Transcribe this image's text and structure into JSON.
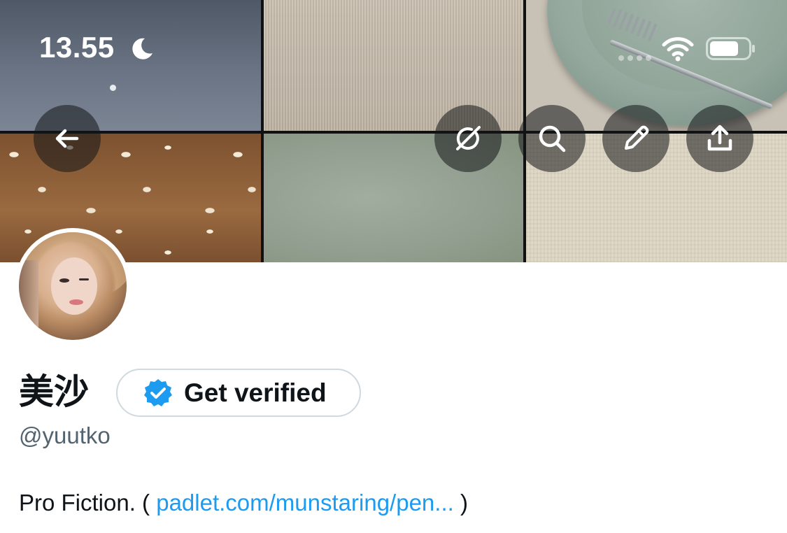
{
  "status_bar": {
    "time": "13.55",
    "icons": [
      "moon-icon",
      "cellular-dots-icon",
      "wifi-icon",
      "battery-icon"
    ]
  },
  "header_actions": {
    "icons": [
      "back-arrow-icon",
      "grok-icon",
      "search-icon",
      "pencil-icon",
      "share-icon"
    ]
  },
  "profile": {
    "display_name": "美沙",
    "handle": "@yuutko",
    "get_verified_label": "Get verified",
    "bio_prefix": "Pro Fiction. ( ",
    "bio_link": "padlet.com/munstaring/pen...",
    "bio_suffix": " )"
  },
  "colors": {
    "link": "#1d9bf0",
    "verified_badge": "#1d9bf0",
    "text_primary": "#0f1419",
    "text_secondary": "#536471"
  }
}
